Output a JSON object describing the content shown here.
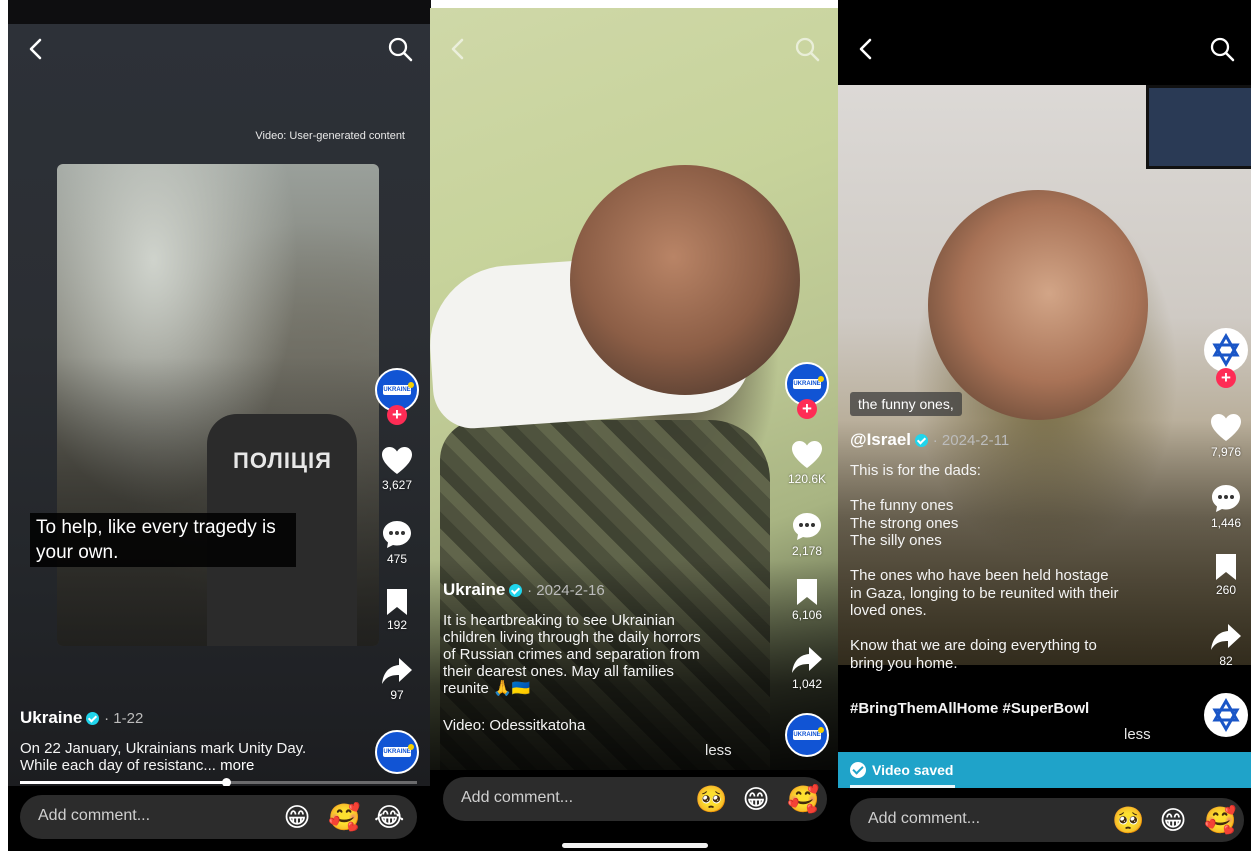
{
  "panels": [
    {
      "username": "Ukraine",
      "date": "· 1-22",
      "description": "On 22 January, Ukrainians mark Unity Day. While each day of resistanc...",
      "more_label": "more",
      "video_overlay_caption": "To help, like every tragedy is your own.",
      "video_label": "Video: User-generated content",
      "vest_text": "ПОЛІЦІЯ",
      "avatar_text": "UKRAINE",
      "likes": "3,627",
      "comments": "475",
      "saves": "192",
      "shares": "97",
      "progress_fraction": 0.52,
      "comment_placeholder": "Add comment...",
      "emojis": [
        "😁",
        "🥰",
        "😂"
      ]
    },
    {
      "username": "Ukraine",
      "date": "· 2024-2-16",
      "description_lines": [
        "It is heartbreaking to see Ukrainian",
        "children living through the daily horrors",
        "of Russian crimes and separation from",
        "their dearest ones. May all families",
        "reunite 🙏🇺🇦"
      ],
      "video_credit": "Video: Odessitkatoha",
      "less_label": "less",
      "avatar_text": "UKRAINE",
      "likes": "120.6K",
      "comments": "2,178",
      "saves": "6,106",
      "shares": "1,042",
      "comment_placeholder": "Add comment...",
      "emojis": [
        "🥺",
        "😁",
        "🥰"
      ]
    },
    {
      "username": "@Israel",
      "date": "· 2024-2-11",
      "tag_pill": "the funny ones,",
      "description_lines": [
        "This is for the dads:",
        "",
        "The funny ones",
        "The strong ones",
        "The silly ones",
        "",
        "The ones who have been held hostage",
        "in Gaza, longing to be reunited with their",
        "loved ones.",
        "",
        "Know that we are doing everything to",
        "bring you home."
      ],
      "hashtags": "#BringThemAllHome #SuperBowl",
      "less_label": "less",
      "likes": "7,976",
      "comments": "1,446",
      "saves": "260",
      "shares": "82",
      "saved_banner": "Video saved",
      "comment_placeholder": "Add comment...",
      "emojis": [
        "🥺",
        "😁",
        "🥰"
      ]
    }
  ],
  "colors": {
    "like_red": "#fe2c55",
    "ukraine_blue": "#1154d4",
    "saved_banner": "#1fa3c9",
    "verified": "#20d5ec"
  }
}
